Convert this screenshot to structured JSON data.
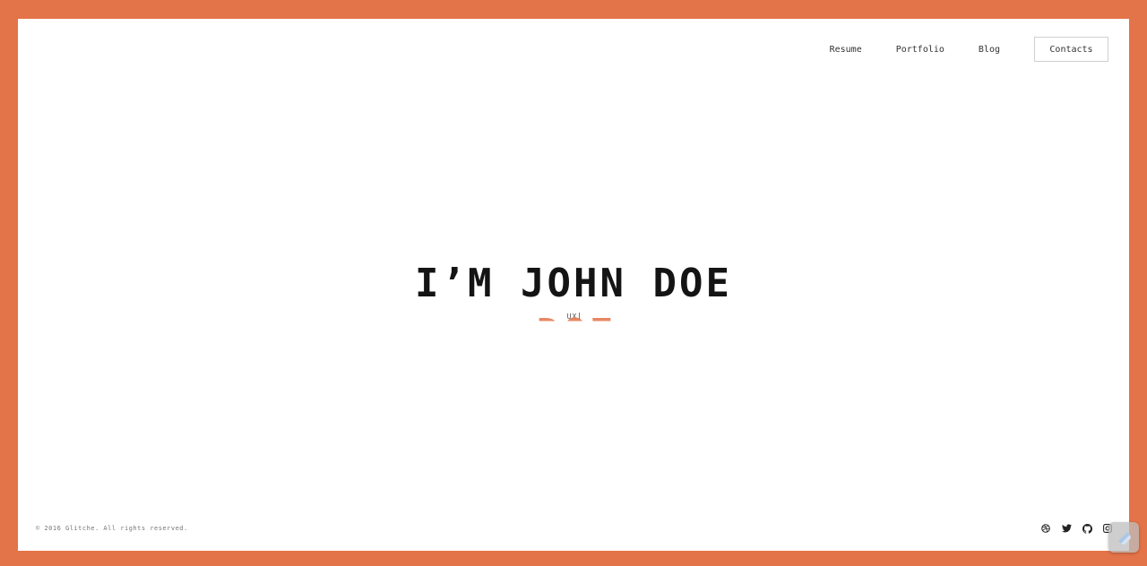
{
  "nav": {
    "items": [
      {
        "label": "Resume"
      },
      {
        "label": "Portfolio"
      },
      {
        "label": "Blog"
      }
    ],
    "contacts_label": "Contacts"
  },
  "hero": {
    "title": "I’M JOHN DOE",
    "subtitle": "UX"
  },
  "footer": {
    "copyright": "© 2016 Glitche. All rights reserved."
  },
  "social": {
    "icons": [
      "dribbble-icon",
      "twitter-icon",
      "github-icon",
      "instagram-icon"
    ]
  },
  "colors": {
    "accent": "#e37348",
    "text": "#141414",
    "background": "#ffffff"
  }
}
